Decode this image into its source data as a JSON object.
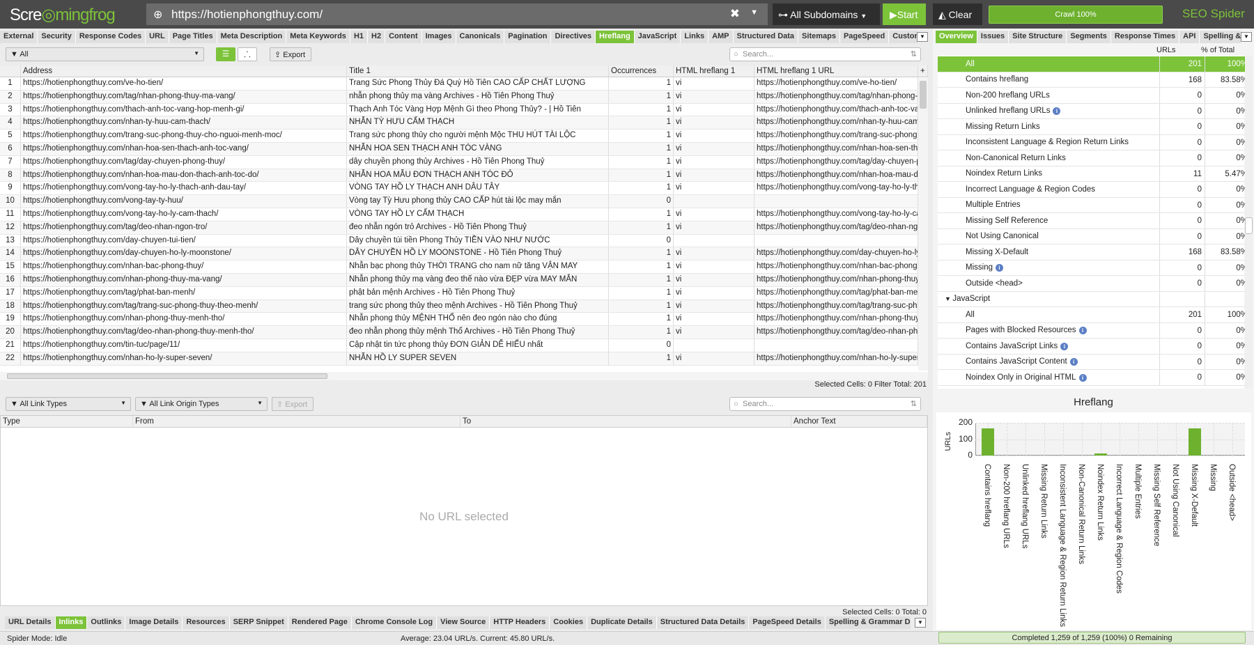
{
  "app": {
    "logo": "Screamingfrog",
    "logo_a": "Scre",
    "logo_b": "mingfrog",
    "url": "https://hotienphongthuy.com/",
    "subdomains": "All Subdomains",
    "start": "Start",
    "clear": "Clear",
    "crawl": "Crawl 100%",
    "product_a": "SEO",
    "product_b": " Spider"
  },
  "main_tabs": [
    "External",
    "Security",
    "Response Codes",
    "URL",
    "Page Titles",
    "Meta Description",
    "Meta Keywords",
    "H1",
    "H2",
    "Content",
    "Images",
    "Canonicals",
    "Pagination",
    "Directives",
    "Hreflang",
    "JavaScript",
    "Links",
    "AMP",
    "Structured Data",
    "Sitemaps",
    "PageSpeed",
    "Custom Search",
    "Custor"
  ],
  "main_active_tab": "Hreflang",
  "filter": {
    "value": "All",
    "export": "Export",
    "search_placeholder": "Search..."
  },
  "table": {
    "columns": [
      "",
      "Address",
      "Title 1",
      "Occurrences",
      "HTML hreflang 1",
      "HTML hreflang 1 URL"
    ],
    "rows": [
      [
        "1",
        "https://hotienphongthuy.com/ve-ho-tien/",
        "Trang Sức Phong Thủy Đá Quý Hồ Tiên CAO CẤP CHẤT LƯỢNG",
        "1",
        "vi",
        "https://hotienphongthuy.com/ve-ho-tien/"
      ],
      [
        "2",
        "https://hotienphongthuy.com/tag/nhan-phong-thuy-ma-vang/",
        "nhẫn phong thủy mạ vàng Archives - Hồ Tiên Phong Thuỷ",
        "1",
        "vi",
        "https://hotienphongthuy.com/tag/nhan-phong-thuy-ma-vang/"
      ],
      [
        "3",
        "https://hotienphongthuy.com/thach-anh-toc-vang-hop-menh-gi/",
        "Thạch Anh Tóc Vàng Hợp Mệnh Gì theo Phong Thủy? - | Hồ Tiên",
        "1",
        "vi",
        "https://hotienphongthuy.com/thach-anh-toc-vang-hop-menh-gi/"
      ],
      [
        "4",
        "https://hotienphongthuy.com/nhan-ty-huu-cam-thach/",
        "NHẪN TỲ HƯU CẨM THẠCH",
        "1",
        "vi",
        "https://hotienphongthuy.com/nhan-ty-huu-cam-thach/"
      ],
      [
        "5",
        "https://hotienphongthuy.com/trang-suc-phong-thuy-cho-nguoi-menh-moc/",
        "Trang sức phong thủy cho người mệnh Mộc THU HÚT TÀI LỘC",
        "1",
        "vi",
        "https://hotienphongthuy.com/trang-suc-phong-thuy-cho-nguoi-menh-moc/"
      ],
      [
        "6",
        "https://hotienphongthuy.com/nhan-hoa-sen-thach-anh-toc-vang/",
        "NHẪN HOA SEN THẠCH ANH TÓC VÀNG",
        "1",
        "vi",
        "https://hotienphongthuy.com/nhan-hoa-sen-thach-anh-toc-vang/"
      ],
      [
        "7",
        "https://hotienphongthuy.com/tag/day-chuyen-phong-thuy/",
        "dây chuyền phong thủy Archives - Hồ Tiên Phong Thuỷ",
        "1",
        "vi",
        "https://hotienphongthuy.com/tag/day-chuyen-phong-thuy/"
      ],
      [
        "8",
        "https://hotienphongthuy.com/nhan-hoa-mau-don-thach-anh-toc-do/",
        "NHẪN HOA MẪU ĐƠN THẠCH ANH TÓC ĐỎ",
        "1",
        "vi",
        "https://hotienphongthuy.com/nhan-hoa-mau-don-thach-anh-toc-do/"
      ],
      [
        "9",
        "https://hotienphongthuy.com/vong-tay-ho-ly-thach-anh-dau-tay/",
        "VÒNG TAY HỒ LY THẠCH ANH DÂU TÂY",
        "1",
        "vi",
        "https://hotienphongthuy.com/vong-tay-ho-ly-thach-anh-dau-tay/"
      ],
      [
        "10",
        "https://hotienphongthuy.com/vong-tay-ty-huu/",
        "Vòng tay Tỳ Hưu phong thủy CAO CẤP hút tài lộc may mắn",
        "0",
        "",
        ""
      ],
      [
        "11",
        "https://hotienphongthuy.com/vong-tay-ho-ly-cam-thach/",
        "VÒNG TAY HỒ LY CẨM THẠCH",
        "1",
        "vi",
        "https://hotienphongthuy.com/vong-tay-ho-ly-cam-thach/"
      ],
      [
        "12",
        "https://hotienphongthuy.com/tag/deo-nhan-ngon-tro/",
        "đeo nhẫn ngón trỏ Archives - Hồ Tiên Phong Thuỷ",
        "1",
        "vi",
        "https://hotienphongthuy.com/tag/deo-nhan-ngon-tro/"
      ],
      [
        "13",
        "https://hotienphongthuy.com/day-chuyen-tui-tien/",
        "Dây chuyền túi tiền Phong Thủy TIỀN VÀO NHƯ NƯỚC",
        "0",
        "",
        ""
      ],
      [
        "14",
        "https://hotienphongthuy.com/day-chuyen-ho-ly-moonstone/",
        "DÂY CHUYỀN HỒ LY MOONSTONE - Hồ Tiên Phong Thuỷ",
        "1",
        "vi",
        "https://hotienphongthuy.com/day-chuyen-ho-ly-moonstone/"
      ],
      [
        "15",
        "https://hotienphongthuy.com/nhan-bac-phong-thuy/",
        "Nhẫn bạc phong thủy THỜI TRANG cho nam nữ tăng VẬN MAY",
        "1",
        "vi",
        "https://hotienphongthuy.com/nhan-bac-phong-thuy/"
      ],
      [
        "16",
        "https://hotienphongthuy.com/nhan-phong-thuy-ma-vang/",
        "Nhẫn phong thủy mạ vàng đeo thế nào vừa ĐẸP vừa MAY MẮN",
        "1",
        "vi",
        "https://hotienphongthuy.com/nhan-phong-thuy-ma-vang/"
      ],
      [
        "17",
        "https://hotienphongthuy.com/tag/phat-ban-menh/",
        "phật bản mệnh Archives - Hồ Tiên Phong Thuỷ",
        "1",
        "vi",
        "https://hotienphongthuy.com/tag/phat-ban-menh/"
      ],
      [
        "18",
        "https://hotienphongthuy.com/tag/trang-suc-phong-thuy-theo-menh/",
        "trang sức phong thủy theo mệnh Archives - Hồ Tiên Phong Thuỷ",
        "1",
        "vi",
        "https://hotienphongthuy.com/tag/trang-suc-phong-thuy-theo-menh/"
      ],
      [
        "19",
        "https://hotienphongthuy.com/nhan-phong-thuy-menh-tho/",
        "Nhẫn phong thủy MỆNH THỔ nên đeo ngón nào cho đúng",
        "1",
        "vi",
        "https://hotienphongthuy.com/nhan-phong-thuy-menh-tho/"
      ],
      [
        "20",
        "https://hotienphongthuy.com/tag/deo-nhan-phong-thuy-menh-tho/",
        "đeo nhẫn phong thủy mệnh Thổ Archives - Hồ Tiên Phong Thuỷ",
        "1",
        "vi",
        "https://hotienphongthuy.com/tag/deo-nhan-phong-thuy-menh-tho/"
      ],
      [
        "21",
        "https://hotienphongthuy.com/tin-tuc/page/11/",
        "Cập nhật tin tức phong thủy ĐƠN GIẢN DỄ HIỂU nhất",
        "0",
        "",
        ""
      ],
      [
        "22",
        "https://hotienphongthuy.com/nhan-ho-ly-super-seven/",
        "NHẪN HỒ LY SUPER SEVEN",
        "1",
        "vi",
        "https://hotienphongthuy.com/nhan-ho-ly-super-seven/"
      ]
    ],
    "status": "Selected Cells:  0  Filter Total:  201"
  },
  "lower": {
    "link_types": "All Link Types",
    "origin_types": "All Link Origin Types",
    "export": "Export",
    "search_placeholder": "Search...",
    "columns": [
      "Type",
      "From",
      "To",
      "Anchor Text"
    ],
    "empty": "No URL selected",
    "status": "Selected Cells:  0  Total:  0"
  },
  "bottom_tabs": [
    "URL Details",
    "Inlinks",
    "Outlinks",
    "Image Details",
    "Resources",
    "SERP Snippet",
    "Rendered Page",
    "Chrome Console Log",
    "View Source",
    "HTTP Headers",
    "Cookies",
    "Duplicate Details",
    "Structured Data Details",
    "PageSpeed Details",
    "Spelling & Grammar Details"
  ],
  "bottom_active_tab": "Inlinks",
  "statusbar": {
    "mode": "Spider Mode: Idle",
    "rate": "Average: 23.04 URL/s. Current: 45.80 URL/s.",
    "progress": "Completed 1,259 of 1,259 (100%) 0 Remaining",
    "progress_percent": 100
  },
  "right_tabs": [
    "Overview",
    "Issues",
    "Site Structure",
    "Segments",
    "Response Times",
    "API",
    "Spelling & Gramr"
  ],
  "right_active_tab": "Overview",
  "overview": {
    "col_urls": "URLs",
    "col_pct": "% of Total",
    "rows": [
      {
        "label": "All",
        "urls": "201",
        "pct": "100%",
        "selected": true
      },
      {
        "label": "Contains hreflang",
        "urls": "168",
        "pct": "83.58%"
      },
      {
        "label": "Non-200 hreflang URLs",
        "urls": "0",
        "pct": "0%"
      },
      {
        "label": "Unlinked hreflang URLs",
        "urls": "0",
        "pct": "0%",
        "info": true
      },
      {
        "label": "Missing Return Links",
        "urls": "0",
        "pct": "0%"
      },
      {
        "label": "Inconsistent Language & Region Return Links",
        "urls": "0",
        "pct": "0%"
      },
      {
        "label": "Non-Canonical Return Links",
        "urls": "0",
        "pct": "0%"
      },
      {
        "label": "Noindex Return Links",
        "urls": "11",
        "pct": "5.47%"
      },
      {
        "label": "Incorrect Language & Region Codes",
        "urls": "0",
        "pct": "0%"
      },
      {
        "label": "Multiple Entries",
        "urls": "0",
        "pct": "0%"
      },
      {
        "label": "Missing Self Reference",
        "urls": "0",
        "pct": "0%"
      },
      {
        "label": "Not Using Canonical",
        "urls": "0",
        "pct": "0%"
      },
      {
        "label": "Missing X-Default",
        "urls": "168",
        "pct": "83.58%"
      },
      {
        "label": "Missing",
        "urls": "0",
        "pct": "0%",
        "info": true
      },
      {
        "label": "Outside <head>",
        "urls": "0",
        "pct": "0%"
      },
      {
        "label": "JavaScript",
        "urls": "",
        "pct": "",
        "group": true
      },
      {
        "label": "All",
        "urls": "201",
        "pct": "100%"
      },
      {
        "label": "Pages with Blocked Resources",
        "urls": "0",
        "pct": "0%",
        "info": true
      },
      {
        "label": "Contains JavaScript Links",
        "urls": "0",
        "pct": "0%",
        "info": true
      },
      {
        "label": "Contains JavaScript Content",
        "urls": "0",
        "pct": "0%",
        "info": true
      },
      {
        "label": "Noindex Only in Original HTML",
        "urls": "0",
        "pct": "0%",
        "info": true
      }
    ]
  },
  "chart_data": {
    "type": "bar",
    "title": "Hreflang",
    "ylabel": "URLs",
    "xlabel": "",
    "ylim": [
      0,
      200
    ],
    "yticks": [
      0,
      100,
      200
    ],
    "grid": true,
    "bar_color": "#6db12f",
    "categories": [
      "Contains hreflang",
      "Non-200 hreflang URLs",
      "Unlinked hreflang URLs",
      "Missing Return Links",
      "Inconsistent Language & Region Return Links",
      "Non-Canonical Return Links",
      "Noindex Return Links",
      "Incorrect Language & Region Codes",
      "Multiple Entries",
      "Missing Self Reference",
      "Not Using Canonical",
      "Missing X-Default",
      "Missing",
      "Outside <head>"
    ],
    "values": [
      168,
      0,
      0,
      0,
      0,
      0,
      11,
      0,
      0,
      0,
      0,
      168,
      0,
      0
    ]
  },
  "colors": {
    "accent": "#7cc33a",
    "topbar": "#4a4a4a"
  }
}
